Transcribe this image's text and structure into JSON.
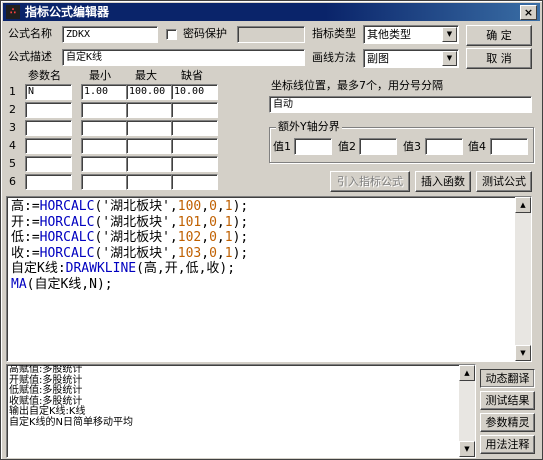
{
  "window": {
    "title": "指标公式编辑器",
    "icon_text": "∴",
    "close": "×"
  },
  "form": {
    "name_label": "公式名称",
    "name_value": "ZDKX",
    "password_label": "密码保护",
    "password_checked": false,
    "desc_label": "公式描述",
    "desc_value": "自定K线",
    "type_label": "指标类型",
    "type_value": "其他类型",
    "draw_label": "画线方法",
    "draw_value": "副图"
  },
  "buttons": {
    "ok": "确  定",
    "cancel": "取  消",
    "import": "引入指标公式",
    "insert_fn": "插入函数",
    "test": "测试公式",
    "dynamic_translate": "动态翻译",
    "test_result": "测试结果",
    "param_wizard": "参数精灵",
    "usage_notes": "用法注释"
  },
  "params": {
    "headers": [
      "参数名",
      "最小",
      "最大",
      "缺省"
    ],
    "rows": [
      {
        "num": "1",
        "name": "N",
        "min": "1.00",
        "max": "100.00",
        "default": "10.00"
      },
      {
        "num": "2",
        "name": "",
        "min": "",
        "max": "",
        "default": ""
      },
      {
        "num": "3",
        "name": "",
        "min": "",
        "max": "",
        "default": ""
      },
      {
        "num": "4",
        "name": "",
        "min": "",
        "max": "",
        "default": ""
      },
      {
        "num": "5",
        "name": "",
        "min": "",
        "max": "",
        "default": ""
      },
      {
        "num": "6",
        "name": "",
        "min": "",
        "max": "",
        "default": ""
      }
    ]
  },
  "coord": {
    "label": "坐标线位置，最多7个，用分号分隔",
    "value": "自动"
  },
  "extra_y": {
    "title": "额外Y轴分界",
    "labels": [
      "值1",
      "值2",
      "值3",
      "值4"
    ],
    "values": [
      "",
      "",
      "",
      ""
    ]
  },
  "code_lines": [
    [
      {
        "t": "高:=",
        "c": "var"
      },
      {
        "t": "HORCALC",
        "c": "fn"
      },
      {
        "t": "('湖北板块',",
        "c": "str"
      },
      {
        "t": "100",
        "c": "num"
      },
      {
        "t": ",",
        "c": "op"
      },
      {
        "t": "0",
        "c": "num"
      },
      {
        "t": ",",
        "c": "op"
      },
      {
        "t": "1",
        "c": "num"
      },
      {
        "t": ");",
        "c": "op"
      }
    ],
    [
      {
        "t": "开:=",
        "c": "var"
      },
      {
        "t": "HORCALC",
        "c": "fn"
      },
      {
        "t": "('湖北板块',",
        "c": "str"
      },
      {
        "t": "101",
        "c": "num"
      },
      {
        "t": ",",
        "c": "op"
      },
      {
        "t": "0",
        "c": "num"
      },
      {
        "t": ",",
        "c": "op"
      },
      {
        "t": "1",
        "c": "num"
      },
      {
        "t": ");",
        "c": "op"
      }
    ],
    [
      {
        "t": "低:=",
        "c": "var"
      },
      {
        "t": "HORCALC",
        "c": "fn"
      },
      {
        "t": "('湖北板块',",
        "c": "str"
      },
      {
        "t": "102",
        "c": "num"
      },
      {
        "t": ",",
        "c": "op"
      },
      {
        "t": "0",
        "c": "num"
      },
      {
        "t": ",",
        "c": "op"
      },
      {
        "t": "1",
        "c": "num"
      },
      {
        "t": ");",
        "c": "op"
      }
    ],
    [
      {
        "t": "收:=",
        "c": "var"
      },
      {
        "t": "HORCALC",
        "c": "fn"
      },
      {
        "t": "('湖北板块',",
        "c": "str"
      },
      {
        "t": "103",
        "c": "num"
      },
      {
        "t": ",",
        "c": "op"
      },
      {
        "t": "0",
        "c": "num"
      },
      {
        "t": ",",
        "c": "op"
      },
      {
        "t": "1",
        "c": "num"
      },
      {
        "t": ");",
        "c": "op"
      }
    ],
    [
      {
        "t": "自定K线:",
        "c": "var"
      },
      {
        "t": "DRAWKLINE",
        "c": "fn"
      },
      {
        "t": "(高,开,低,收);",
        "c": "op"
      }
    ],
    [
      {
        "t": "MA",
        "c": "fn"
      },
      {
        "t": "(自定K线,N);",
        "c": "op"
      }
    ]
  ],
  "output_lines": [
    "高赋值:多股统计",
    "开赋值:多股统计",
    "低赋值:多股统计",
    "收赋值:多股统计",
    "输出自定K线:K线",
    "自定K线的N日简单移动平均"
  ],
  "colors": {
    "title_bar": "#0a246a",
    "function": "#0000c0",
    "number": "#c06000"
  }
}
